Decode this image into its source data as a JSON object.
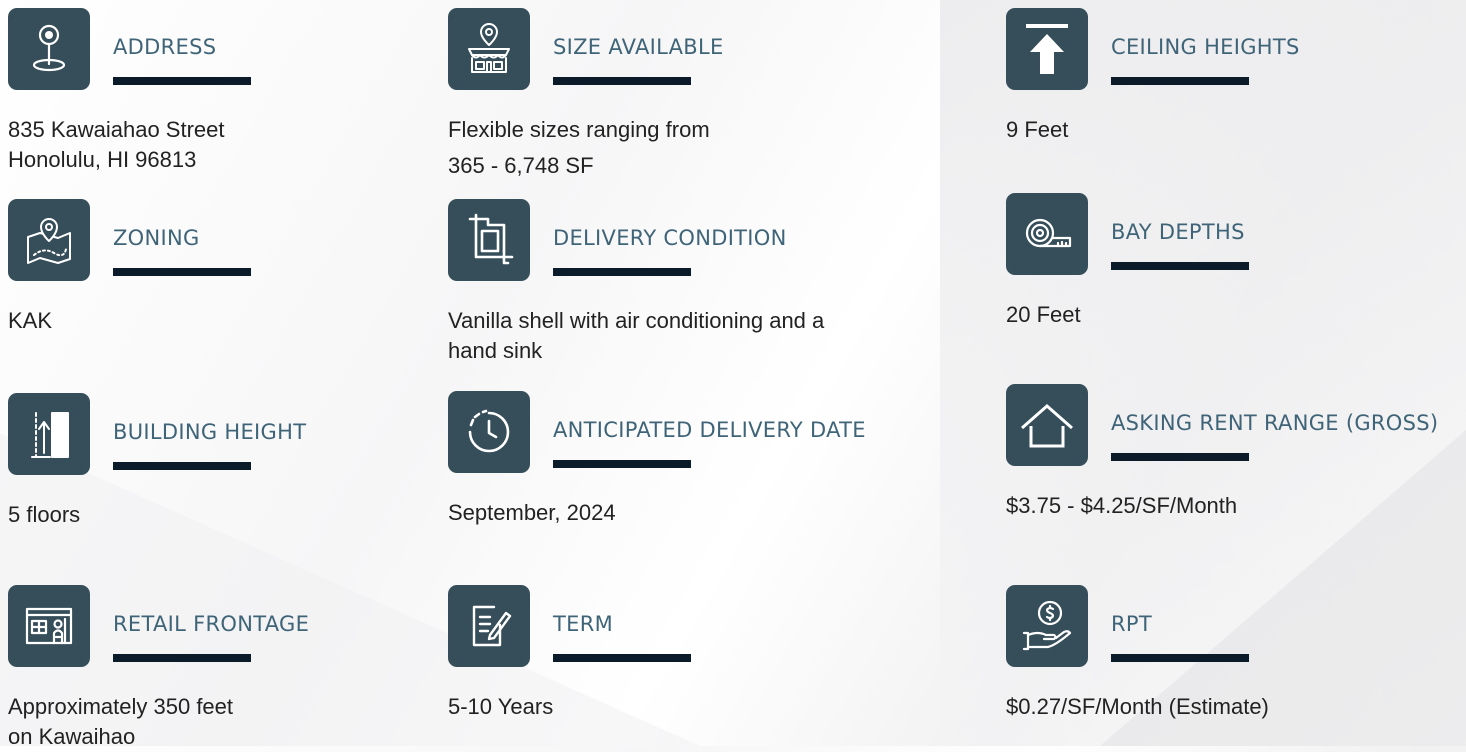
{
  "features": [
    {
      "id": "address",
      "label": "ADDRESS",
      "icon": "location-pin-icon",
      "lines": [
        "835 Kawaiahao Street",
        "Honolulu, HI 96813"
      ]
    },
    {
      "id": "zoning",
      "label": "ZONING",
      "icon": "map-pin-icon",
      "lines": [
        "KAK"
      ]
    },
    {
      "id": "building-height",
      "label": "BUILDING HEIGHT",
      "icon": "building-height-icon",
      "lines": [
        "5 floors"
      ]
    },
    {
      "id": "retail-frontage",
      "label": "RETAIL FRONTAGE",
      "icon": "storefront-icon",
      "lines": [
        "Approximately 350 feet",
        "on Kawaihao"
      ]
    },
    {
      "id": "size-available",
      "label": "SIZE AVAILABLE",
      "icon": "store-location-icon",
      "lines": [
        "Flexible sizes ranging from",
        "365 - 6,748 SF"
      ]
    },
    {
      "id": "delivery-condition",
      "label": "DELIVERY CONDITION",
      "icon": "crop-icon",
      "lines": [
        "Vanilla shell with air conditioning and a",
        "hand sink"
      ]
    },
    {
      "id": "delivery-date",
      "label": "ANTICIPATED DELIVERY DATE",
      "icon": "clock-icon",
      "lines": [
        "September, 2024"
      ]
    },
    {
      "id": "term",
      "label": "TERM",
      "icon": "edit-document-icon",
      "lines": [
        "5-10 Years"
      ]
    },
    {
      "id": "ceiling-heights",
      "label": "CEILING HEIGHTS",
      "icon": "arrow-up-icon",
      "lines": [
        "9 Feet"
      ]
    },
    {
      "id": "bay-depths",
      "label": "BAY DEPTHS",
      "icon": "tape-measure-icon",
      "lines": [
        "20 Feet"
      ]
    },
    {
      "id": "asking-rent",
      "label": "ASKING RENT RANGE (GROSS)",
      "icon": "house-icon",
      "lines": [
        "$3.75 - $4.25/SF/Month"
      ]
    },
    {
      "id": "rpt",
      "label": "RPT",
      "icon": "dollar-hand-icon",
      "lines": [
        "$0.27/SF/Month (Estimate)"
      ]
    }
  ]
}
